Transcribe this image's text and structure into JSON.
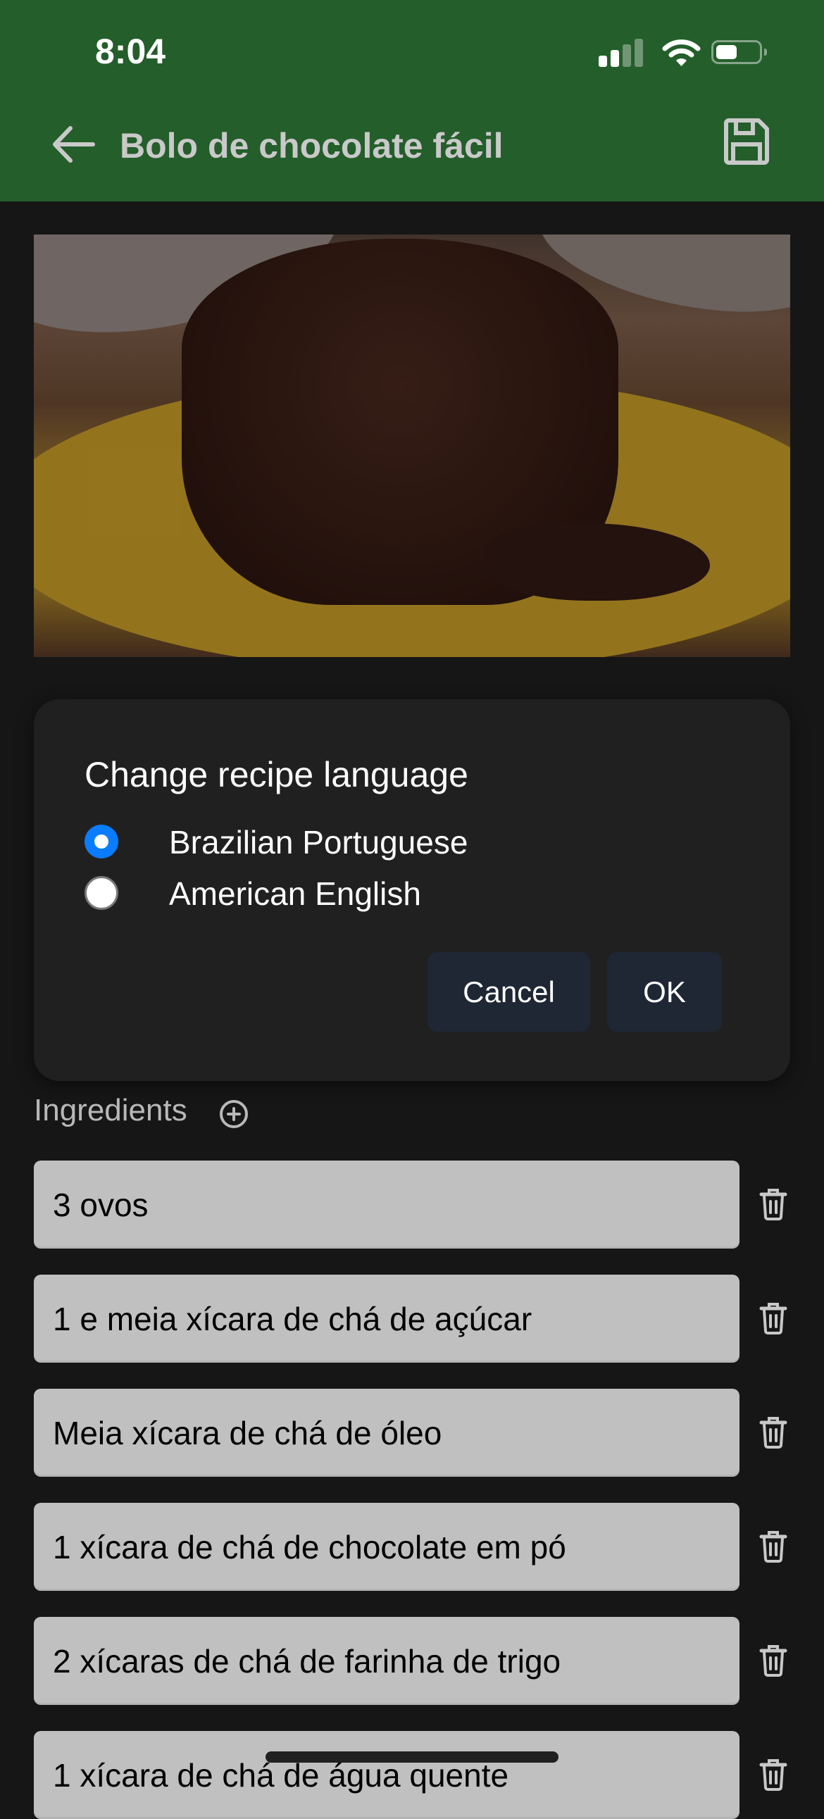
{
  "status_bar": {
    "time": "8:04",
    "signal_bars_active": 2,
    "signal_bars_total": 4,
    "wifi": "wifi-icon",
    "battery_level": 0.5
  },
  "header": {
    "title": "Bolo de chocolate fácil",
    "back_icon": "arrow-left-icon",
    "save_icon": "floppy-disk-icon",
    "background_color": "#245e2b"
  },
  "hero_image": {
    "alt": "Chocolate cake slice on yellow plate"
  },
  "dialog": {
    "title": "Change recipe language",
    "options": [
      {
        "label": "Brazilian Portuguese",
        "selected": true
      },
      {
        "label": "American English",
        "selected": false
      }
    ],
    "cancel_label": "Cancel",
    "ok_label": "OK",
    "accent_color": "#0a7cff"
  },
  "ingredients": {
    "label": "Ingredients",
    "add_icon": "plus-circle-icon",
    "delete_icon": "trash-icon",
    "items": [
      "3 ovos",
      "1 e meia xícara de chá de açúcar",
      "Meia xícara de chá de óleo",
      "1 xícara de chá de chocolate em pó",
      "2 xícaras de chá de farinha de trigo",
      "1 xícara de chá de água quente"
    ]
  }
}
